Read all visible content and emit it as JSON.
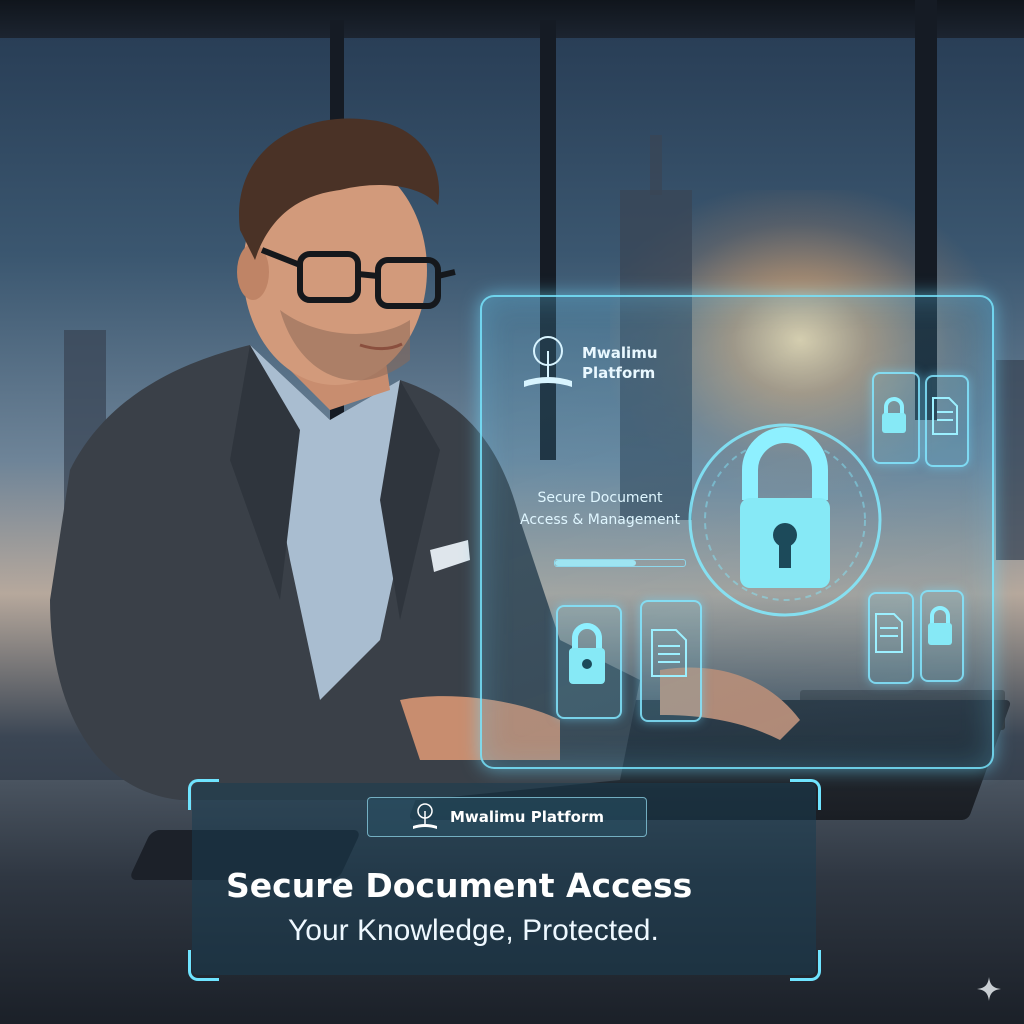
{
  "hologram": {
    "brand_name": "Mwalimu Platform",
    "title": "Secure Document Access & Management",
    "progress": 0.62
  },
  "overlay": {
    "badge_label": "Mwalimu Platform",
    "headline": "Secure Document Access",
    "tagline": "Your Knowledge, Protected."
  },
  "colors": {
    "accent": "#6fe4ff",
    "headline": "#ffffff"
  },
  "icons": [
    "book-tree-logo-icon",
    "padlock-icon",
    "document-icon",
    "sparkle-icon"
  ]
}
